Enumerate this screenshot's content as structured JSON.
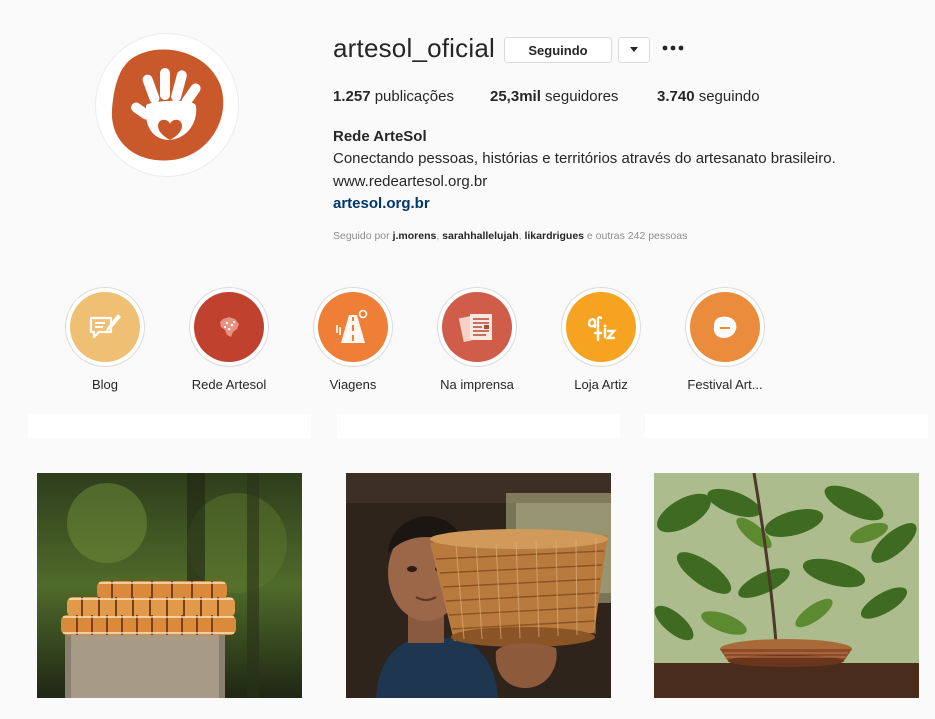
{
  "profile": {
    "username": "artesol_oficial",
    "follow_label": "Seguindo",
    "stats": {
      "posts_value": "1.257",
      "posts_label": "publicações",
      "followers_value": "25,3mil",
      "followers_label": "seguidores",
      "following_value": "3.740",
      "following_label": "seguindo"
    },
    "bio": {
      "name": "Rede ArteSol",
      "line1": "Conectando pessoas, histórias e territórios através do artesanato brasileiro.",
      "line2": "www.redeartesol.org.br",
      "link": "artesol.org.br"
    },
    "followed_by": {
      "prefix": "Seguido por",
      "users": [
        "j.morens",
        "sarahhallelujah",
        "likardrigues"
      ],
      "sep": ",",
      "suffix": "e outras 242 pessoas"
    },
    "avatar_color": "#c9582a"
  },
  "highlights": [
    {
      "label": "Blog",
      "icon": "edit-note-icon",
      "color": "#efbf73"
    },
    {
      "label": "Rede Artesol",
      "icon": "brazil-map-icon",
      "color": "#c0422e"
    },
    {
      "label": "Viagens",
      "icon": "road-icon",
      "color": "#ef7f36"
    },
    {
      "label": "Na imprensa",
      "icon": "newspaper-icon",
      "color": "#cf5d4a"
    },
    {
      "label": "Loja Artiz",
      "icon": "artiz-logo-icon",
      "color": "#f7a322"
    },
    {
      "label": "Festival Art...",
      "icon": "artesol-logo-icon",
      "color": "#ea8c3c"
    }
  ],
  "grid": [
    {
      "name": "post-woven-bracelets",
      "accent": "#d98a3a"
    },
    {
      "name": "post-artisan-basket",
      "accent": "#b97a3e"
    },
    {
      "name": "post-basket-plants",
      "accent": "#8d4b2a"
    }
  ]
}
